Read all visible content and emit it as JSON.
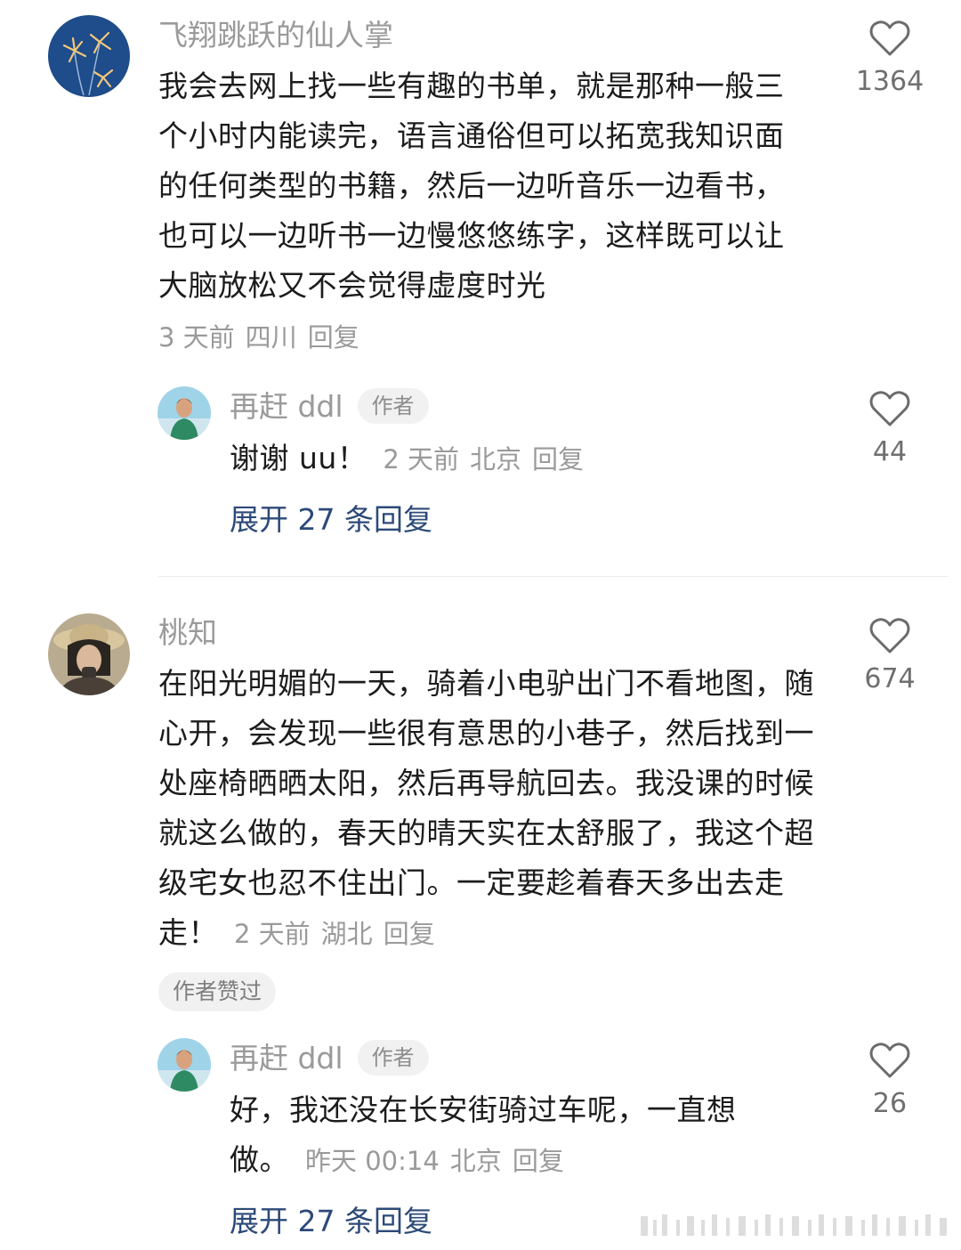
{
  "comments": [
    {
      "username": "飞翔跳跃的仙人掌",
      "text": "我会去网上找一些有趣的书单，就是那种一般三个小时内能读完，语言通俗但可以拓宽我知识面的任何类型的书籍，然后一边听音乐一边看书，也可以一边听书一边慢悠悠练字，这样既可以让大脑放松又不会觉得虚度时光",
      "time": "3 天前",
      "location": "四川",
      "reply_label": "回复",
      "likes": "1364",
      "reply": {
        "username": "再赶 ddl",
        "author_tag": "作者",
        "text": "谢谢 uu！",
        "time": "2 天前",
        "location": "北京",
        "reply_label": "回复",
        "likes": "44"
      },
      "expand_label": "展开 27 条回复"
    },
    {
      "username": "桃知",
      "text": "在阳光明媚的一天，骑着小电驴出门不看地图，随心开，会发现一些很有意思的小巷子，然后找到一处座椅晒晒太阳，然后再导航回去。我没课的时候就这么做的，春天的晴天实在太舒服了，我这个超级宅女也忍不住出门。一定要趁着春天多出去走走！",
      "time": "2 天前",
      "location": "湖北",
      "reply_label": "回复",
      "likes": "674",
      "badge": "作者赞过",
      "reply": {
        "username": "再赶 ddl",
        "author_tag": "作者",
        "text": "好，我还没在长安街骑过车呢，一直想做。",
        "time": "昨天 00:14",
        "location": "北京",
        "reply_label": "回复",
        "likes": "26"
      },
      "expand_label": "展开 27 条回复"
    }
  ],
  "icons": {
    "like": "heart-outline-icon"
  },
  "colors": {
    "link": "#2c4a78",
    "meta": "#9a9a9a",
    "text": "#1c1c1c"
  }
}
